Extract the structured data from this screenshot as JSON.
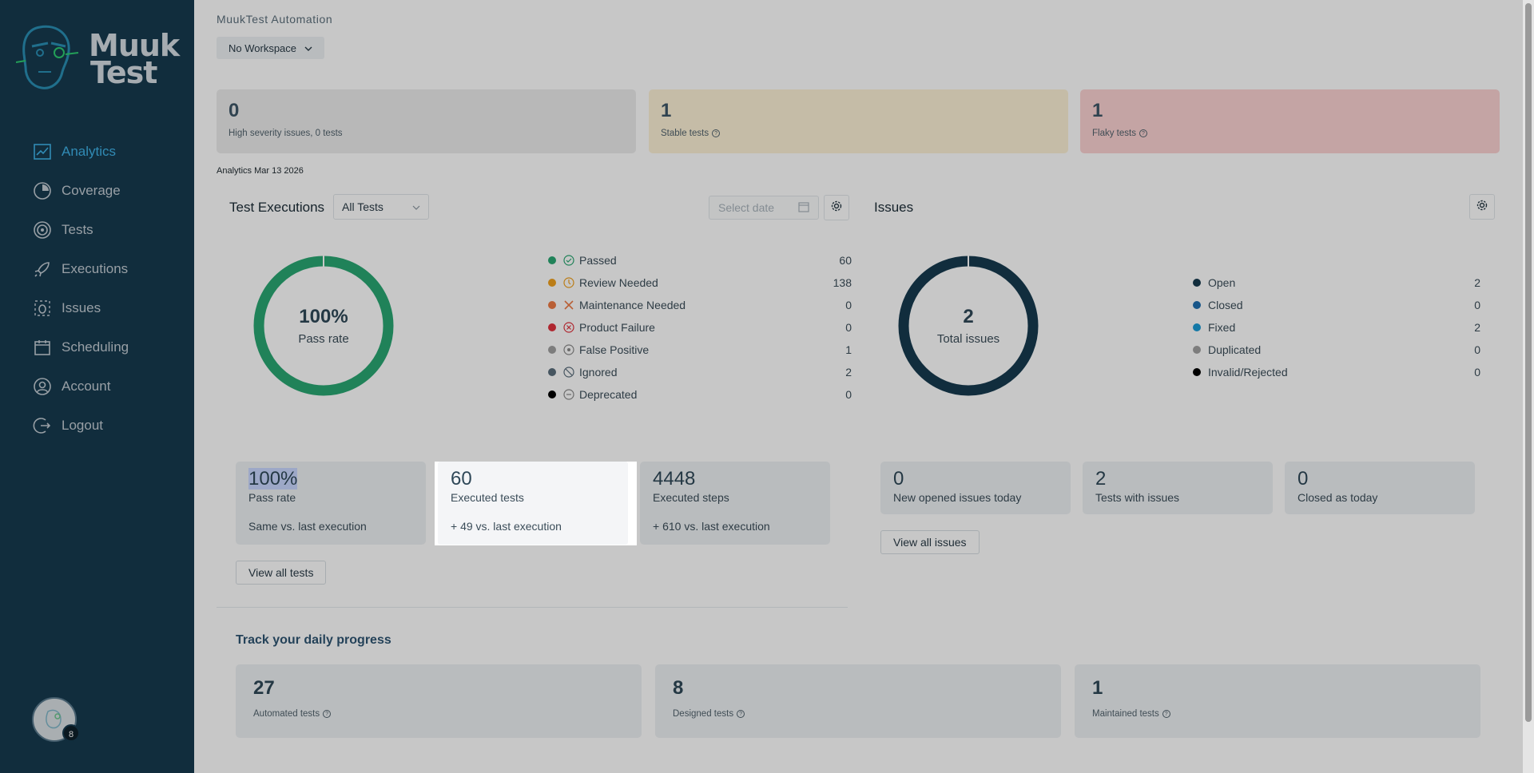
{
  "brand": {
    "line1": "Muuk",
    "line2": "Test"
  },
  "nav": [
    {
      "label": "Analytics",
      "icon": "chart-line-icon",
      "active": true
    },
    {
      "label": "Coverage",
      "icon": "pie-icon"
    },
    {
      "label": "Tests",
      "icon": "target-icon"
    },
    {
      "label": "Executions",
      "icon": "rocket-icon"
    },
    {
      "label": "Issues",
      "icon": "bug-icon"
    },
    {
      "label": "Scheduling",
      "icon": "calendar-icon"
    },
    {
      "label": "Account",
      "icon": "user-icon"
    },
    {
      "label": "Logout",
      "icon": "logout-icon"
    }
  ],
  "avatar": {
    "badge": "8"
  },
  "header": {
    "app_title": "MuukTest Automation",
    "workspace": "No Workspace"
  },
  "top_cards": [
    {
      "value": "0",
      "caption": "High severity issues, 0 tests",
      "color": "#ececec"
    },
    {
      "value": "1",
      "caption": "Stable tests",
      "color": "#fdf1d6"
    },
    {
      "value": "1",
      "caption": "Flaky tests",
      "color": "#fcd2d2"
    }
  ],
  "analytics_date": "Analytics Mar 13 2026",
  "executions": {
    "title": "Test Executions",
    "filter": "All Tests",
    "date_placeholder": "Select date",
    "donut_value": "100%",
    "donut_label": "Pass rate",
    "legend": [
      {
        "label": "Passed",
        "value": "60",
        "color": "#2aa772"
      },
      {
        "label": "Review Needed",
        "value": "138",
        "color": "#f0a01e"
      },
      {
        "label": "Maintenance Needed",
        "value": "0",
        "color": "#ee7a45"
      },
      {
        "label": "Product Failure",
        "value": "0",
        "color": "#e0323e"
      },
      {
        "label": "False Positive",
        "value": "1",
        "color": "#a0a0a0"
      },
      {
        "label": "Ignored",
        "value": "2",
        "color": "#5a6e7c"
      },
      {
        "label": "Deprecated",
        "value": "0",
        "color": "#000000"
      }
    ],
    "stats": [
      {
        "value": "100%",
        "title": "Pass rate",
        "delta": "Same vs. last execution"
      },
      {
        "value": "60",
        "title": "Executed tests",
        "delta": "+ 49 vs. last execution"
      },
      {
        "value": "4448",
        "title": "Executed steps",
        "delta": "+ 610 vs. last execution"
      }
    ],
    "view_all": "View all tests"
  },
  "issues": {
    "title": "Issues",
    "donut_value": "2",
    "donut_label": "Total issues",
    "legend": [
      {
        "label": "Open",
        "value": "2",
        "color": "#163a4f"
      },
      {
        "label": "Closed",
        "value": "0",
        "color": "#1f6fb0"
      },
      {
        "label": "Fixed",
        "value": "2",
        "color": "#1a9bd6"
      },
      {
        "label": "Duplicated",
        "value": "0",
        "color": "#a0a0a0"
      },
      {
        "label": "Invalid/Rejected",
        "value": "0",
        "color": "#000000"
      }
    ],
    "stats": [
      {
        "value": "0",
        "title": "New opened issues today"
      },
      {
        "value": "2",
        "title": "Tests with issues"
      },
      {
        "value": "0",
        "title": "Closed as today"
      }
    ],
    "view_all": "View all issues"
  },
  "daily": {
    "title": "Track your daily progress",
    "cards": [
      {
        "value": "27",
        "caption": "Automated tests"
      },
      {
        "value": "8",
        "caption": "Designed tests"
      },
      {
        "value": "1",
        "caption": "Maintained tests"
      }
    ]
  }
}
